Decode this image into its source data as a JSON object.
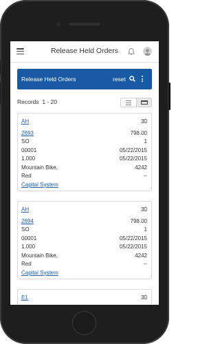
{
  "header": {
    "title": "Release Held Orders",
    "menu_icon": "hamburger-menu-icon",
    "bell_icon": "bell-icon",
    "avatar_icon": "user-avatar-icon"
  },
  "action_bar": {
    "title": "Release Held Orders",
    "reset_label": "reset",
    "search_icon": "search-icon",
    "more_icon": "more-vertical-icon",
    "color": "#195aa5"
  },
  "records": {
    "label": "Records",
    "range": "1 - 20"
  },
  "cards": [
    {
      "code": "AH",
      "qty": "30",
      "order": "2693",
      "amount": "798.00",
      "type": "SO",
      "line": "1",
      "seq": "00001",
      "date1": "05/22/2015",
      "rate": "1.000",
      "date2": "05/22/2015",
      "item1": "Mountain Bike,",
      "item_no": "4242",
      "item2": "Red",
      "dash": "--",
      "company": "Capital System"
    },
    {
      "code": "AH",
      "qty": "30",
      "order": "2694",
      "amount": "798.00",
      "type": "SO",
      "line": "1",
      "seq": "00001",
      "date1": "05/22/2015",
      "rate": "1.000",
      "date2": "05/22/2015",
      "item1": "Mountain Bike,",
      "item_no": "4242",
      "item2": "Red",
      "dash": "--",
      "company": "Capital System"
    },
    {
      "code": "E1",
      "qty": "30"
    }
  ]
}
